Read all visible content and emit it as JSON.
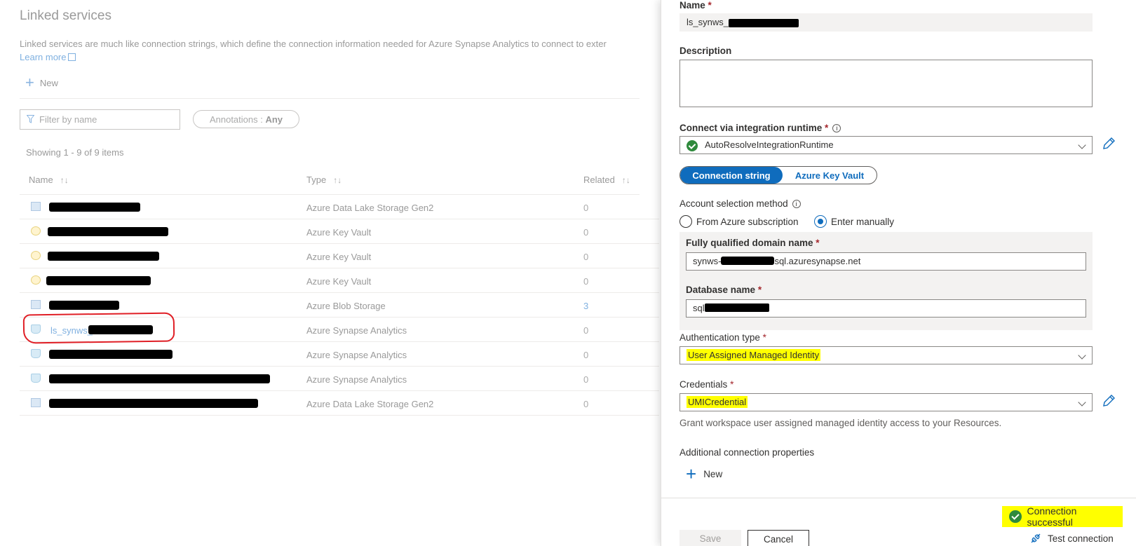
{
  "left": {
    "title": "Linked services",
    "description": "Linked services are much like connection strings, which define the connection information needed for Azure Synapse Analytics to connect to exter",
    "learn_more": "Learn more",
    "new_label": "New",
    "filter_placeholder": "Filter by name",
    "annotations_label": "Annotations :",
    "annotations_value": "Any",
    "showing": "Showing 1 - 9 of 9 items",
    "columns": {
      "name": "Name",
      "type": "Type",
      "related": "Related",
      "sort_glyph": "↑↓"
    },
    "rows": [
      {
        "icon": "storage-icon",
        "name": "",
        "type": "Azure Data Lake Storage Gen2",
        "related": "0"
      },
      {
        "icon": "key-vault-icon",
        "name": "",
        "type": "Azure Key Vault",
        "related": "0"
      },
      {
        "icon": "key-vault-icon",
        "name": "",
        "type": "Azure Key Vault",
        "related": "0"
      },
      {
        "icon": "key-vault-icon",
        "name": "",
        "type": "Azure Key Vault",
        "related": "0"
      },
      {
        "icon": "blob-storage-icon",
        "name": "",
        "type": "Azure Blob Storage",
        "related": "3"
      },
      {
        "icon": "synapse-icon",
        "name": "ls_synws_",
        "type": "Azure Synapse Analytics",
        "related": "0"
      },
      {
        "icon": "synapse-icon",
        "name": "",
        "type": "Azure Synapse Analytics",
        "related": "0"
      },
      {
        "icon": "synapse-icon",
        "name": "",
        "type": "Azure Synapse Analytics",
        "related": "0"
      },
      {
        "icon": "storage-icon",
        "name": "",
        "type": "Azure Data Lake Storage Gen2",
        "related": "0"
      }
    ]
  },
  "panel": {
    "name_label": "Name",
    "name_value": "ls_synws_",
    "description_label": "Description",
    "description_value": "",
    "runtime_label": "Connect via integration runtime",
    "runtime_value": "AutoResolveIntegrationRuntime",
    "toggle_on": "Connection string",
    "toggle_off": "Azure Key Vault",
    "account_label": "Account selection method",
    "radio_sub": "From Azure subscription",
    "radio_manual": "Enter manually",
    "fqdn_label": "Fully qualified domain name",
    "fqdn_prefix": "synws-",
    "fqdn_suffix": "sql.azuresynapse.net",
    "db_label": "Database name",
    "db_prefix": "sql",
    "auth_label": "Authentication type",
    "auth_value": "User Assigned Managed Identity",
    "cred_label": "Credentials",
    "cred_value": "UMICredential",
    "helper": "Grant workspace user assigned managed identity access to your Resources.",
    "additional_label": "Additional connection properties",
    "new_label": "New",
    "status": "Connection successful",
    "save": "Save",
    "cancel": "Cancel",
    "test": "Test connection",
    "required_mark": "*",
    "info_glyph": "i"
  },
  "colors": {
    "accent": "#0f6cbd",
    "highlight": "#ffff00",
    "success": "#2f8a3c",
    "annotation_red": "#e01f26"
  }
}
